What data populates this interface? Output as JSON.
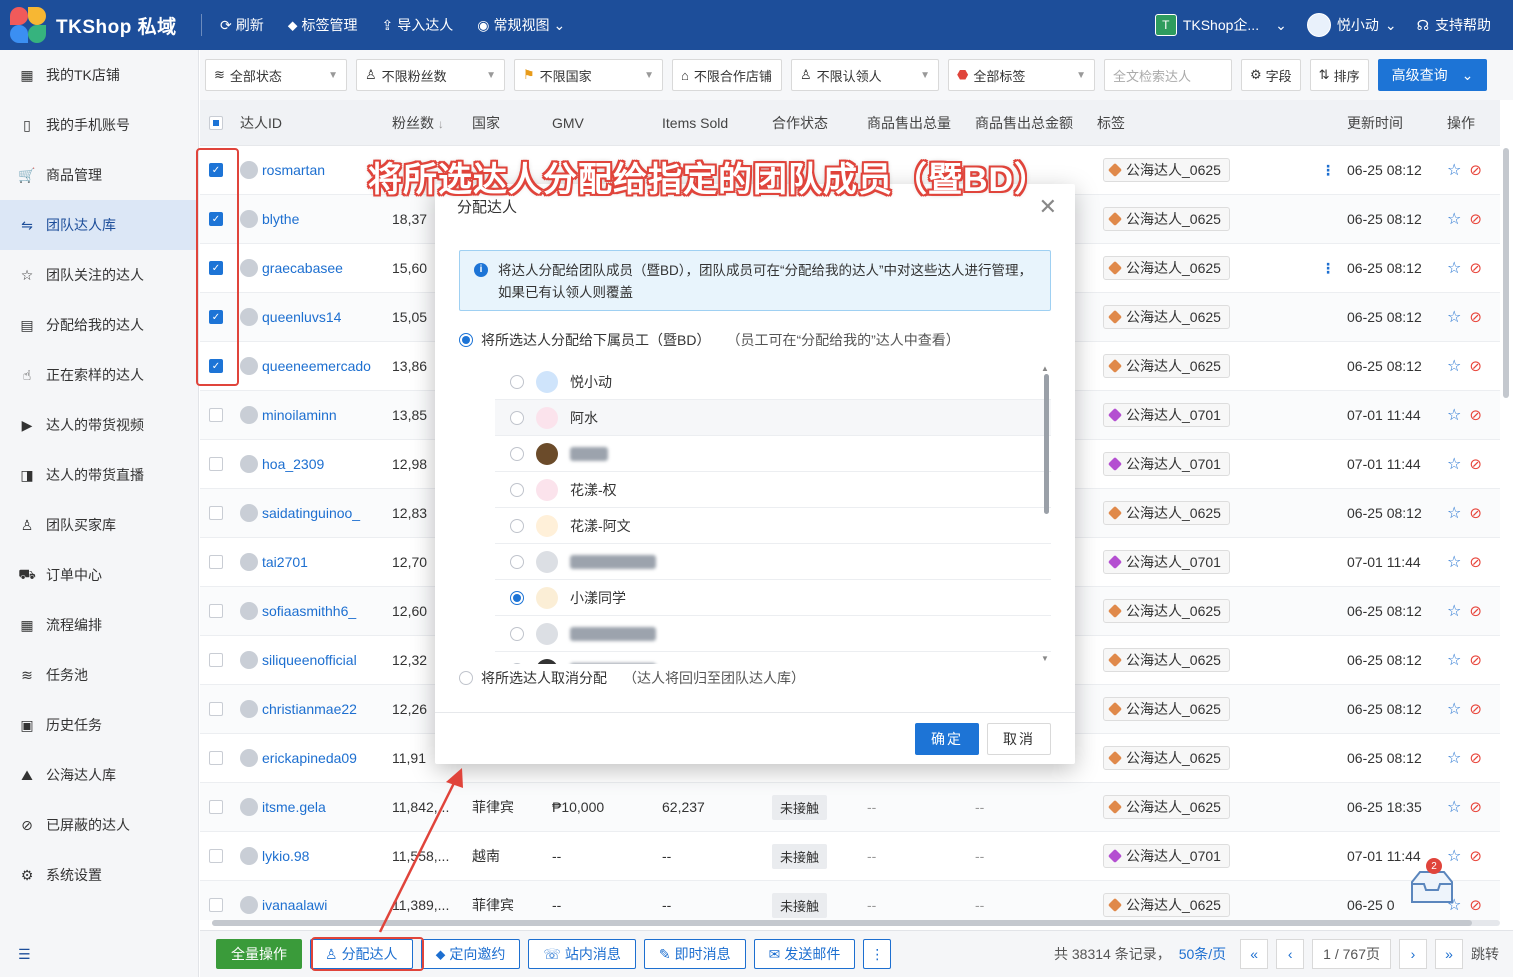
{
  "app": {
    "name": "TKShop 私域"
  },
  "topbar": {
    "refresh": "刷新",
    "tag_manage": "标签管理",
    "import": "导入达人",
    "view": "常规视图",
    "team": "TKShop企...",
    "user": "悦小动",
    "help": "支持帮助"
  },
  "sidebar": {
    "items": [
      {
        "label": "我的TK店铺",
        "icon": "store-icon"
      },
      {
        "label": "我的手机账号",
        "icon": "phone-icon"
      },
      {
        "label": "商品管理",
        "icon": "cart-icon"
      },
      {
        "label": "团队达人库",
        "icon": "team-icon"
      },
      {
        "label": "团队关注的达人",
        "icon": "star-icon"
      },
      {
        "label": "分配给我的达人",
        "icon": "assign-icon"
      },
      {
        "label": "正在索样的达人",
        "icon": "hand-icon"
      },
      {
        "label": "达人的带货视频",
        "icon": "video-icon"
      },
      {
        "label": "达人的带货直播",
        "icon": "live-icon"
      },
      {
        "label": "团队买家库",
        "icon": "buyer-icon"
      },
      {
        "label": "订单中心",
        "icon": "truck-icon"
      },
      {
        "label": "流程编排",
        "icon": "calendar-icon"
      },
      {
        "label": "任务池",
        "icon": "layers-icon"
      },
      {
        "label": "历史任务",
        "icon": "clipboard-icon"
      },
      {
        "label": "公海达人库",
        "icon": "pool-icon"
      },
      {
        "label": "已屏蔽的达人",
        "icon": "block-icon"
      },
      {
        "label": "系统设置",
        "icon": "gear-icon"
      }
    ],
    "active_index": 3
  },
  "filters": {
    "status": "全部状态",
    "fans": "不限粉丝数",
    "country": "不限国家",
    "shop": "不限合作店铺",
    "claimer": "不限认领人",
    "tags": "全部标签",
    "search_placeholder": "全文检索达人",
    "fields": "字段",
    "sort": "排序",
    "advanced": "高级查询"
  },
  "table": {
    "headers": {
      "id": "达人ID",
      "fans": "粉丝数",
      "country": "国家",
      "gmv": "GMV",
      "items": "Items Sold",
      "coop": "合作状态",
      "qty": "商品售出总量",
      "amt": "商品售出总金额",
      "tag": "标签",
      "time": "更新时间",
      "op": "操作"
    },
    "rows": [
      {
        "id": "rosmartan",
        "fans": "₱",
        "country": "",
        "gmv": "",
        "items": "",
        "coop": "",
        "qty": "",
        "amt": "",
        "tag": "公海达人_0625",
        "tag_color": "#e0894a",
        "time": "06-25 08:12",
        "checked": true,
        "more": true
      },
      {
        "id": "blythe",
        "fans": "18,37",
        "country": "",
        "gmv": "",
        "items": "",
        "coop": "",
        "qty": "",
        "amt": "",
        "tag": "公海达人_0625",
        "tag_color": "#e0894a",
        "time": "06-25 08:12",
        "checked": true,
        "more": false
      },
      {
        "id": "graecabasee",
        "fans": "15,60",
        "country": "",
        "gmv": "",
        "items": "",
        "coop": "",
        "qty": "",
        "amt": "",
        "tag": "公海达人_0625",
        "tag_color": "#e0894a",
        "time": "06-25 08:12",
        "checked": true,
        "more": true
      },
      {
        "id": "queenluvs14",
        "fans": "15,05",
        "country": "",
        "gmv": "",
        "items": "",
        "coop": "",
        "qty": "",
        "amt": "",
        "tag": "公海达人_0625",
        "tag_color": "#e0894a",
        "time": "06-25 08:12",
        "checked": true,
        "more": false
      },
      {
        "id": "queeneemercado",
        "fans": "13,86",
        "country": "",
        "gmv": "",
        "items": "",
        "coop": "",
        "qty": "",
        "amt": "",
        "tag": "公海达人_0625",
        "tag_color": "#e0894a",
        "time": "06-25 08:12",
        "checked": true,
        "more": false
      },
      {
        "id": "minoilaminn",
        "fans": "13,85",
        "country": "",
        "gmv": "",
        "items": "",
        "coop": "",
        "qty": "",
        "amt": "",
        "tag": "公海达人_0701",
        "tag_color": "#b44fd1",
        "time": "07-01 11:44",
        "checked": false,
        "more": false
      },
      {
        "id": "hoa_2309",
        "fans": "12,98",
        "country": "",
        "gmv": "",
        "items": "",
        "coop": "",
        "qty": "",
        "amt": "",
        "tag": "公海达人_0701",
        "tag_color": "#b44fd1",
        "time": "07-01 11:44",
        "checked": false,
        "more": false
      },
      {
        "id": "saidatinguinoo_",
        "fans": "12,83",
        "country": "",
        "gmv": "",
        "items": "",
        "coop": "",
        "qty": "",
        "amt": "",
        "tag": "公海达人_0625",
        "tag_color": "#e0894a",
        "time": "06-25 08:12",
        "checked": false,
        "more": false
      },
      {
        "id": "tai2701",
        "fans": "12,70",
        "country": "",
        "gmv": "",
        "items": "",
        "coop": "",
        "qty": "",
        "amt": "",
        "tag": "公海达人_0701",
        "tag_color": "#b44fd1",
        "time": "07-01 11:44",
        "checked": false,
        "more": false
      },
      {
        "id": "sofiaasmithh6_",
        "fans": "12,60",
        "country": "",
        "gmv": "",
        "items": "",
        "coop": "",
        "qty": "",
        "amt": "",
        "tag": "公海达人_0625",
        "tag_color": "#e0894a",
        "time": "06-25 08:12",
        "checked": false,
        "more": false
      },
      {
        "id": "siliqueenofficial",
        "fans": "12,32",
        "country": "",
        "gmv": "",
        "items": "",
        "coop": "",
        "qty": "",
        "amt": "",
        "tag": "公海达人_0625",
        "tag_color": "#e0894a",
        "time": "06-25 08:12",
        "checked": false,
        "more": false
      },
      {
        "id": "christianmae22",
        "fans": "12,26",
        "country": "",
        "gmv": "",
        "items": "",
        "coop": "",
        "qty": "",
        "amt": "",
        "tag": "公海达人_0625",
        "tag_color": "#e0894a",
        "time": "06-25 08:12",
        "checked": false,
        "more": false
      },
      {
        "id": "erickapineda09",
        "fans": "11,91",
        "country": "",
        "gmv": "",
        "items": "",
        "coop": "",
        "qty": "",
        "amt": "",
        "tag": "公海达人_0625",
        "tag_color": "#e0894a",
        "time": "06-25 08:12",
        "checked": false,
        "more": false
      },
      {
        "id": "itsme.gela",
        "fans": "11,842,...",
        "country": "菲律宾",
        "gmv": "₱10,000",
        "items": "62,237",
        "coop": "未接触",
        "qty": "--",
        "amt": "--",
        "tag": "公海达人_0625",
        "tag_color": "#e0894a",
        "time": "06-25 18:35",
        "checked": false,
        "more": false
      },
      {
        "id": "lykio.98",
        "fans": "11,558,...",
        "country": "越南",
        "gmv": "--",
        "items": "--",
        "coop": "未接触",
        "qty": "--",
        "amt": "--",
        "tag": "公海达人_0701",
        "tag_color": "#b44fd1",
        "time": "07-01 11:44",
        "checked": false,
        "more": false
      },
      {
        "id": "ivanaalawi",
        "fans": "11,389,...",
        "country": "菲律宾",
        "gmv": "--",
        "items": "--",
        "coop": "未接触",
        "qty": "--",
        "amt": "--",
        "tag": "公海达人_0625",
        "tag_color": "#e0894a",
        "time": "06-25 0",
        "checked": false,
        "more": false
      }
    ]
  },
  "bottombar": {
    "all_ops": "全量操作",
    "assign": "分配达人",
    "invite": "定向邀约",
    "station_msg": "站内消息",
    "instant_msg": "即时消息",
    "email": "发送邮件",
    "more": "⋮",
    "total": "共 38314 条记录，",
    "page_size": "50条/页",
    "page": "1 / 767页",
    "jump": "跳转"
  },
  "inbox_badge": "2",
  "modal": {
    "title": "分配达人",
    "info": "将达人分配给团队成员（暨BD），团队成员可在“分配给我的达人”中对这些达人进行管理，如果已有认领人则覆盖",
    "option_assign": "将所选达人分配给下属员工（暨BD）",
    "option_assign_hint": "（员工可在“分配给我的”达人中查看）",
    "option_unassign": "将所选达人取消分配",
    "option_unassign_hint": "（达人将回归至团队达人库）",
    "members": [
      {
        "name": "悦小动",
        "selected": false,
        "hidden": false
      },
      {
        "name": "阿水",
        "selected": false,
        "hidden": false
      },
      {
        "name": "",
        "selected": false,
        "hidden": true
      },
      {
        "name": "花漾-权",
        "selected": false,
        "hidden": false
      },
      {
        "name": "花漾-阿文",
        "selected": false,
        "hidden": false
      },
      {
        "name": "",
        "selected": false,
        "hidden": true
      },
      {
        "name": "小漾同学",
        "selected": true,
        "hidden": false
      },
      {
        "name": "",
        "selected": false,
        "hidden": true
      },
      {
        "name": "",
        "selected": false,
        "hidden": true
      }
    ],
    "ok": "确定",
    "cancel": "取消"
  },
  "annotation": {
    "callout": "将所选达人分配给指定的团队成员（暨BD）",
    "color": "#e0443b"
  }
}
